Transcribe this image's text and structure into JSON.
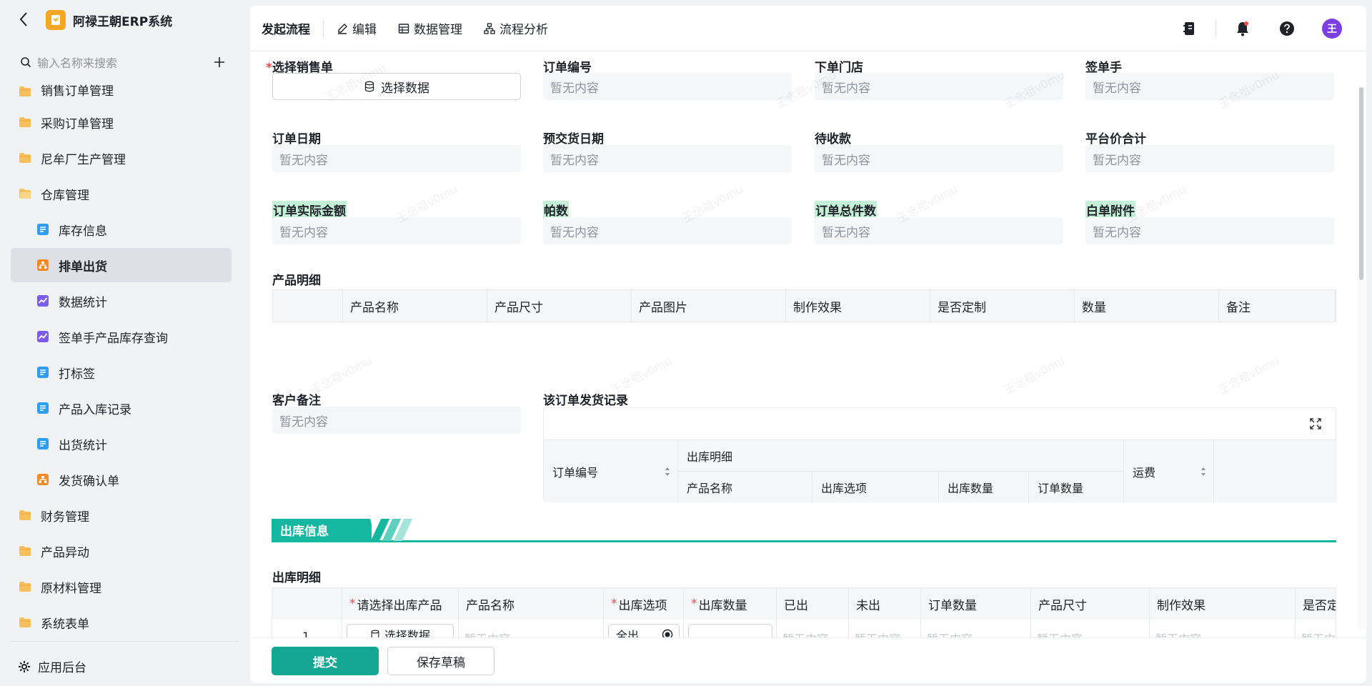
{
  "app": {
    "title": "阿禄王朝ERP系统"
  },
  "sidebar": {
    "search_placeholder": "输入名称来搜索",
    "items": [
      {
        "label": "销售订单管理",
        "icon": "folder-icon"
      },
      {
        "label": "采购订单管理",
        "icon": "folder-icon"
      },
      {
        "label": "尼牟厂生产管理",
        "icon": "folder-icon"
      },
      {
        "label": "仓库管理",
        "icon": "folder-open-icon"
      },
      {
        "label": "库存信息",
        "icon": "form-icon"
      },
      {
        "label": "排单出货",
        "icon": "flow-icon",
        "active": true
      },
      {
        "label": "数据统计",
        "icon": "report-icon"
      },
      {
        "label": "签单手产品库存查询",
        "icon": "report-icon"
      },
      {
        "label": "打标签",
        "icon": "form-icon"
      },
      {
        "label": "产品入库记录",
        "icon": "form-icon"
      },
      {
        "label": "出货统计",
        "icon": "form-icon"
      },
      {
        "label": "发货确认单",
        "icon": "flow-icon"
      },
      {
        "label": "财务管理",
        "icon": "folder-icon"
      },
      {
        "label": "产品异动",
        "icon": "folder-icon"
      },
      {
        "label": "原材料管理",
        "icon": "folder-icon"
      },
      {
        "label": "系统表单",
        "icon": "folder-icon"
      }
    ],
    "admin_label": "应用后台"
  },
  "topbar": {
    "tabs": [
      "发起流程",
      "编辑",
      "数据管理",
      "流程分析"
    ],
    "avatar": "王"
  },
  "form": {
    "empty": "暂无内容",
    "select_data": "选择数据",
    "fields": {
      "select_order": "选择销售单",
      "order_no": "订单编号",
      "store": "下单门店",
      "signer": "签单手",
      "order_date": "订单日期",
      "delivery_date": "预交货日期",
      "receivable": "待收款",
      "platform_total": "平台价合计",
      "actual_amount": "订单实际金额",
      "frames": "帕数",
      "total_pieces": "订单总件数",
      "white_attach": "白单附件",
      "product_detail": "产品明细",
      "customer_note": "客户备注",
      "ship_records": "该订单发货记录"
    },
    "product_columns": [
      "产品名称",
      "产品尺寸",
      "产品图片",
      "制作效果",
      "是否定制",
      "数量",
      "备注"
    ],
    "ship_columns": {
      "order_no": "订单编号",
      "out_detail": "出库明细",
      "product_name": "产品名称",
      "out_option": "出库选项",
      "out_qty": "出库数量",
      "order_qty": "订单数量",
      "freight": "运费"
    },
    "section_title": "出库信息",
    "out_detail_title": "出库明细",
    "out_columns": [
      "请选择出库产品",
      "产品名称",
      "出库选项",
      "出库数量",
      "已出",
      "未出",
      "订单数量",
      "产品尺寸",
      "制作效果",
      "是否定"
    ],
    "out_required": [
      true,
      false,
      true,
      true,
      false,
      false,
      false,
      false,
      false,
      false
    ],
    "row": {
      "index": "1",
      "select": "选择数据",
      "option": "全出",
      "empty": "暂无内容"
    }
  },
  "footer": {
    "submit": "提交",
    "draft": "保存草稿"
  },
  "colors": {
    "accent": "#14a794",
    "highlight": "#c6efd8",
    "required": "#f54a45"
  }
}
